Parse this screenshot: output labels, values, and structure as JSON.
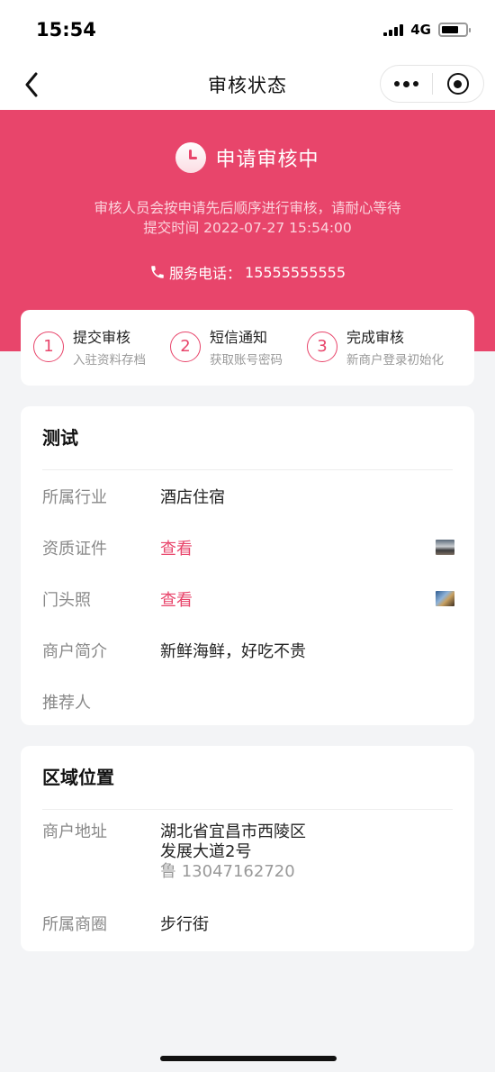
{
  "status_bar": {
    "time": "15:54",
    "network": "4G"
  },
  "nav": {
    "title": "审核状态",
    "back_icon": "chevron-left-icon",
    "more_icon": "more-dots-icon",
    "close_icon": "target-icon"
  },
  "hero": {
    "status_title": "申请审核中",
    "desc_line1": "审核人员会按申请先后顺序进行审核，请耐心等待",
    "desc_line2": "提交时间 2022-07-27 15:54:00",
    "phone_label": "服务电话：",
    "phone_number": "15555555555",
    "color": "#e8456b"
  },
  "steps": [
    {
      "num": "1",
      "title": "提交审核",
      "sub": "入驻资料存档"
    },
    {
      "num": "2",
      "title": "短信通知",
      "sub": "获取账号密码"
    },
    {
      "num": "3",
      "title": "完成审核",
      "sub": "新商户登录初始化"
    }
  ],
  "store_card": {
    "title": "测试",
    "rows": [
      {
        "label": "所属行业",
        "value": "酒店住宿"
      },
      {
        "label": "资质证件",
        "value": "查看"
      },
      {
        "label": "门头照",
        "value": "查看"
      },
      {
        "label": "商户简介",
        "value": "新鲜海鲜，好吃不贵"
      },
      {
        "label": "推荐人",
        "value": ""
      }
    ]
  },
  "location_card": {
    "title": "区域位置",
    "address_label": "商户地址",
    "address_line1": "湖北省宜昌市西陵区",
    "address_line2": "发展大道2号",
    "contact": "鲁 13047162720",
    "district_label": "所属商圈",
    "district_value": "步行街"
  }
}
